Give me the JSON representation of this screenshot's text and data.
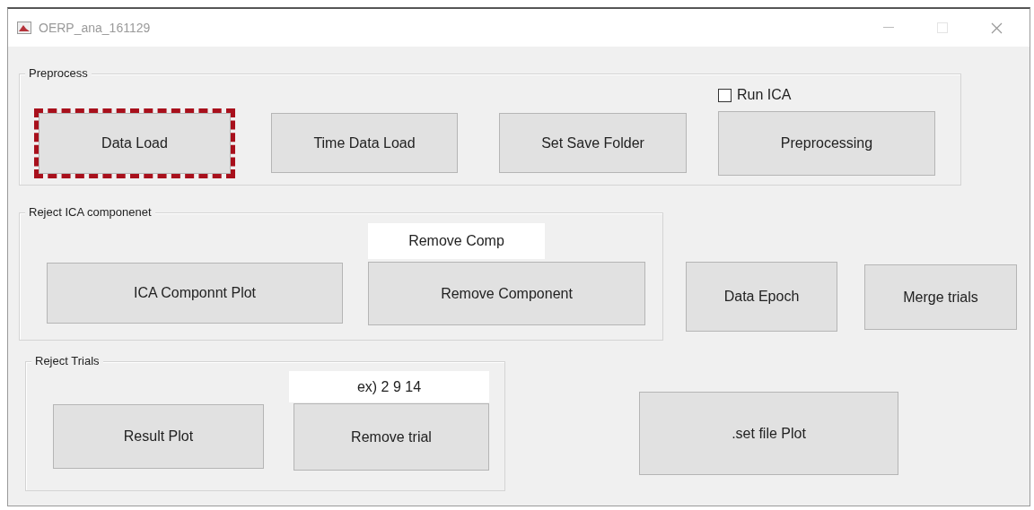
{
  "window": {
    "title": "OERP_ana_161129"
  },
  "preprocess": {
    "title": "Preprocess",
    "buttons": [
      {
        "label": "Data Load",
        "highlighted": true
      },
      {
        "label": "Time Data Load",
        "highlighted": false
      },
      {
        "label": "Set Save Folder",
        "highlighted": false
      }
    ],
    "run_ica": {
      "label": "Run ICA",
      "checked": false
    },
    "preprocessing_button": "Preprocessing"
  },
  "reject_ica": {
    "title": "Reject ICA componenet",
    "plot_button": "ICA Componnt Plot",
    "component_field": {
      "value": "Remove Comp"
    },
    "remove_button": "Remove Component"
  },
  "data_epoch_button": "Data Epoch",
  "merge_trials_button": "Merge trials",
  "reject_trials": {
    "title": "Reject Trials",
    "plot_button": "Result Plot",
    "trial_field": {
      "value": "ex) 2 9 14"
    },
    "remove_button": "Remove trial"
  },
  "set_file_plot_button": ".set file Plot"
}
